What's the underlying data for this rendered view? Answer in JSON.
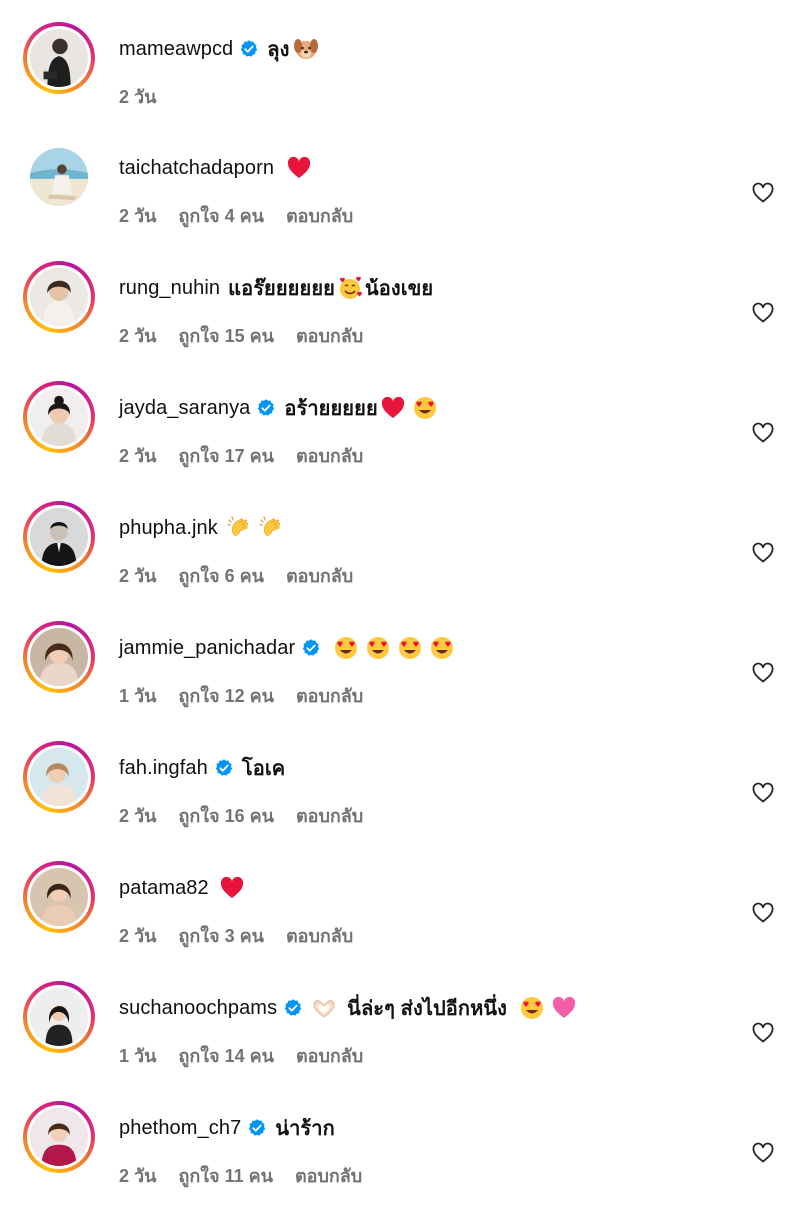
{
  "comments": [
    {
      "username": "mameawpcd",
      "verified": true,
      "text": "ลุง",
      "emojis": [
        "dog-face"
      ],
      "time": "2 วัน",
      "likes": "",
      "reply": "",
      "show_heart": false,
      "ring": true
    },
    {
      "username": "taichatchadaporn",
      "verified": false,
      "text": "",
      "emojis": [
        "red-heart"
      ],
      "time": "2 วัน",
      "likes": "ถูกใจ 4 คน",
      "reply": "ตอบกลับ",
      "show_heart": true,
      "ring": false
    },
    {
      "username": "rung_nuhin",
      "verified": false,
      "text": "แอร๊ยยยยยย",
      "text2": "น้องเขย",
      "emojis": [
        "smiling-hearts"
      ],
      "time": "2 วัน",
      "likes": "ถูกใจ 15 คน",
      "reply": "ตอบกลับ",
      "show_heart": true,
      "ring": true
    },
    {
      "username": "jayda_saranya",
      "verified": true,
      "text": "อร้ายยยยย",
      "emojis": [
        "red-heart",
        "heart-eyes"
      ],
      "time": "2 วัน",
      "likes": "ถูกใจ 17 คน",
      "reply": "ตอบกลับ",
      "show_heart": true,
      "ring": true
    },
    {
      "username": "phupha.jnk",
      "verified": false,
      "text": "",
      "emojis": [
        "clapping-hands",
        "clapping-hands"
      ],
      "time": "2 วัน",
      "likes": "ถูกใจ 6 คน",
      "reply": "ตอบกลับ",
      "show_heart": true,
      "ring": true
    },
    {
      "username": "jammie_panichadar",
      "verified": true,
      "text": "",
      "emojis": [
        "heart-eyes",
        "heart-eyes",
        "heart-eyes",
        "heart-eyes"
      ],
      "time": "1 วัน",
      "likes": "ถูกใจ 12 คน",
      "reply": "ตอบกลับ",
      "show_heart": true,
      "ring": true
    },
    {
      "username": "fah.ingfah",
      "verified": true,
      "text": "โอเค",
      "emojis": [],
      "time": "2 วัน",
      "likes": "ถูกใจ 16 คน",
      "reply": "ตอบกลับ",
      "show_heart": true,
      "ring": true
    },
    {
      "username": "patama82",
      "verified": false,
      "text": "",
      "emojis": [
        "red-heart"
      ],
      "time": "2 วัน",
      "likes": "ถูกใจ 3 คน",
      "reply": "ตอบกลับ",
      "show_heart": true,
      "ring": true
    },
    {
      "username": "suchanoochpams",
      "verified": true,
      "text": "นี่ล่ะๆ ส่งไปอีกหนึ่ง",
      "emojis_before": [
        "heart-hands"
      ],
      "emojis": [
        "heart-eyes",
        "pink-heart"
      ],
      "time": "1 วัน",
      "likes": "ถูกใจ 14 คน",
      "reply": "ตอบกลับ",
      "show_heart": true,
      "ring": true
    },
    {
      "username": "phethom_ch7",
      "verified": true,
      "text": "น่าร้าก",
      "emojis": [],
      "time": "2 วัน",
      "likes": "ถูกใจ 11 คน",
      "reply": "ตอบกลับ",
      "show_heart": true,
      "ring": true
    }
  ],
  "colors": {
    "meta": "#737373",
    "verified": "#0095f6",
    "heart_emoji": "#e8143c",
    "ring_start": "#fdc20a",
    "ring_end": "#dd2a7b"
  },
  "icons": {
    "like": "heart-outline-icon",
    "verified": "verified-badge-icon"
  }
}
